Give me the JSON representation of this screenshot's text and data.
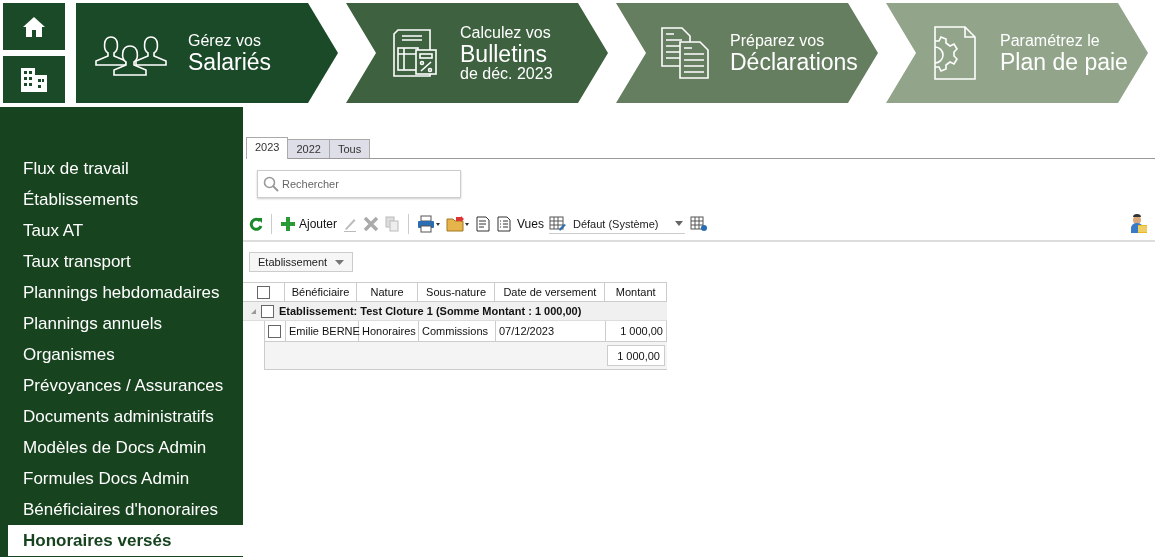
{
  "steps": [
    {
      "line1": "Gérez vos",
      "line2": "Salariés",
      "color": "#1b4a28"
    },
    {
      "line1": "Calculez vos",
      "line2": "Bulletins",
      "line3": "de déc. 2023",
      "color": "#3e6140"
    },
    {
      "line1": "Préparez vos",
      "line2": "Déclarations",
      "color": "#667e60"
    },
    {
      "line1": "Paramétrez le",
      "line2": "Plan de paie",
      "color": "#92a58b"
    }
  ],
  "sidebar": {
    "items": [
      {
        "label": "Flux de travail",
        "selected": false
      },
      {
        "label": "Établissements",
        "selected": false
      },
      {
        "label": "Taux AT",
        "selected": false
      },
      {
        "label": "Taux transport",
        "selected": false
      },
      {
        "label": "Plannings hebdomadaires",
        "selected": false
      },
      {
        "label": "Plannings annuels",
        "selected": false
      },
      {
        "label": "Organismes",
        "selected": false
      },
      {
        "label": "Prévoyances / Assurances",
        "selected": false
      },
      {
        "label": "Documents administratifs",
        "selected": false
      },
      {
        "label": "Modèles de Docs Admin",
        "selected": false
      },
      {
        "label": "Formules Docs Admin",
        "selected": false
      },
      {
        "label": "Bénéficiaires d'honoraires",
        "selected": false
      },
      {
        "label": "Honoraires versés",
        "selected": true
      }
    ]
  },
  "tabs": [
    {
      "label": "2023",
      "selected": true
    },
    {
      "label": "2022",
      "selected": false
    },
    {
      "label": "Tous",
      "selected": false
    }
  ],
  "search": {
    "placeholder": "Rechercher"
  },
  "toolbar": {
    "add": "Ajouter",
    "views": "Vues",
    "view_select": "Défaut (Système)"
  },
  "group_by": "Etablissement",
  "table": {
    "all_checked": false,
    "columns": [
      "Bénéficiaire",
      "Nature",
      "Sous-nature",
      "Date de versement",
      "Montant"
    ],
    "groups": [
      {
        "label": "Etablissement: Test Cloture 1 (Somme Montant : 1 000,00)",
        "expanded": true,
        "checked": false,
        "rows": [
          {
            "cells": [
              "Emilie BERNE",
              "Honoraires",
              "Commissions",
              "07/12/2023",
              "1 000,00"
            ],
            "checked": false
          }
        ],
        "total": "1 000,00"
      }
    ]
  }
}
